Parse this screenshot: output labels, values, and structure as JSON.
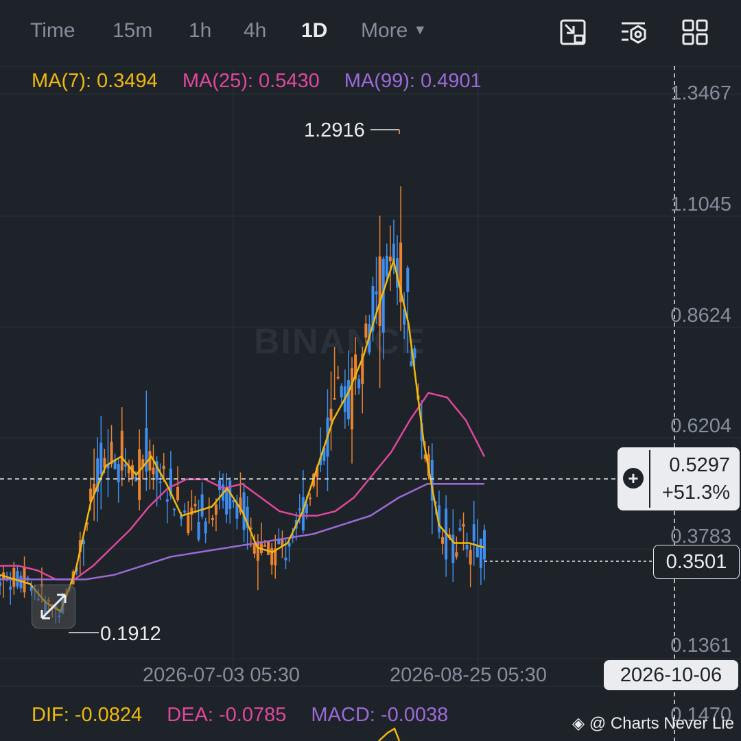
{
  "toolbar": {
    "tabs": [
      {
        "label": "Time"
      },
      {
        "label": "15m"
      },
      {
        "label": "1h"
      },
      {
        "label": "4h"
      },
      {
        "label": "1D",
        "active": true
      },
      {
        "label": "More"
      }
    ],
    "icons": [
      "chart-position-icon",
      "indicator-settings-icon",
      "layout-grid-icon"
    ]
  },
  "ma": {
    "ma7": "MA(7): 0.3494",
    "ma25": "MA(25): 0.5430",
    "ma99": "MA(99): 0.4901"
  },
  "price_axis": [
    "1.3467",
    "1.1045",
    "0.8624",
    "0.6204",
    "0.3783",
    "0.1361"
  ],
  "date_axis": [
    "2026-07-03 05:30",
    "2026-08-25 05:30"
  ],
  "high_label": "1.2916",
  "low_label": "0.1912",
  "crosshair": {
    "price": "0.5297",
    "change": "+51.3%",
    "date": "2026-10-06"
  },
  "last_price": "0.3501",
  "macd": {
    "dif": "DIF: -0.0824",
    "dea": "DEA: -0.0785",
    "macd": "MACD: -0.0038",
    "axis_value": "0.1470"
  },
  "watermark": "BINANCE",
  "credit": "@ Charts Never Lie",
  "colors": {
    "up": "#3d8ef0",
    "down": "#e8832f",
    "ma7": "#f0b90b",
    "ma25": "#e0479e",
    "ma99": "#9c6ad8",
    "background": "#1e2329"
  },
  "chart_data": {
    "type": "line",
    "ylim": [
      0.1361,
      1.3467
    ],
    "series": [
      {
        "name": "MA(7)",
        "values": [
          0.29,
          0.28,
          0.27,
          0.23,
          0.21,
          0.3,
          0.45,
          0.53,
          0.55,
          0.51,
          0.55,
          0.49,
          0.42,
          0.43,
          0.44,
          0.48,
          0.43,
          0.35,
          0.34,
          0.36,
          0.43,
          0.53,
          0.63,
          0.69,
          0.77,
          0.88,
          0.98,
          0.84,
          0.58,
          0.4,
          0.36,
          0.36,
          0.35
        ]
      },
      {
        "name": "MA(25)",
        "values": [
          0.31,
          0.31,
          0.3,
          0.28,
          0.28,
          0.31,
          0.35,
          0.39,
          0.44,
          0.48,
          0.5,
          0.5,
          0.48,
          0.49,
          0.46,
          0.43,
          0.42,
          0.42,
          0.43,
          0.46,
          0.51,
          0.56,
          0.63,
          0.69,
          0.68,
          0.63,
          0.55
        ]
      },
      {
        "name": "MA(99)",
        "values": [
          0.28,
          0.28,
          0.28,
          0.28,
          0.29,
          0.31,
          0.33,
          0.34,
          0.35,
          0.36,
          0.37,
          0.38,
          0.4,
          0.42,
          0.46,
          0.49,
          0.49,
          0.49
        ]
      }
    ]
  }
}
